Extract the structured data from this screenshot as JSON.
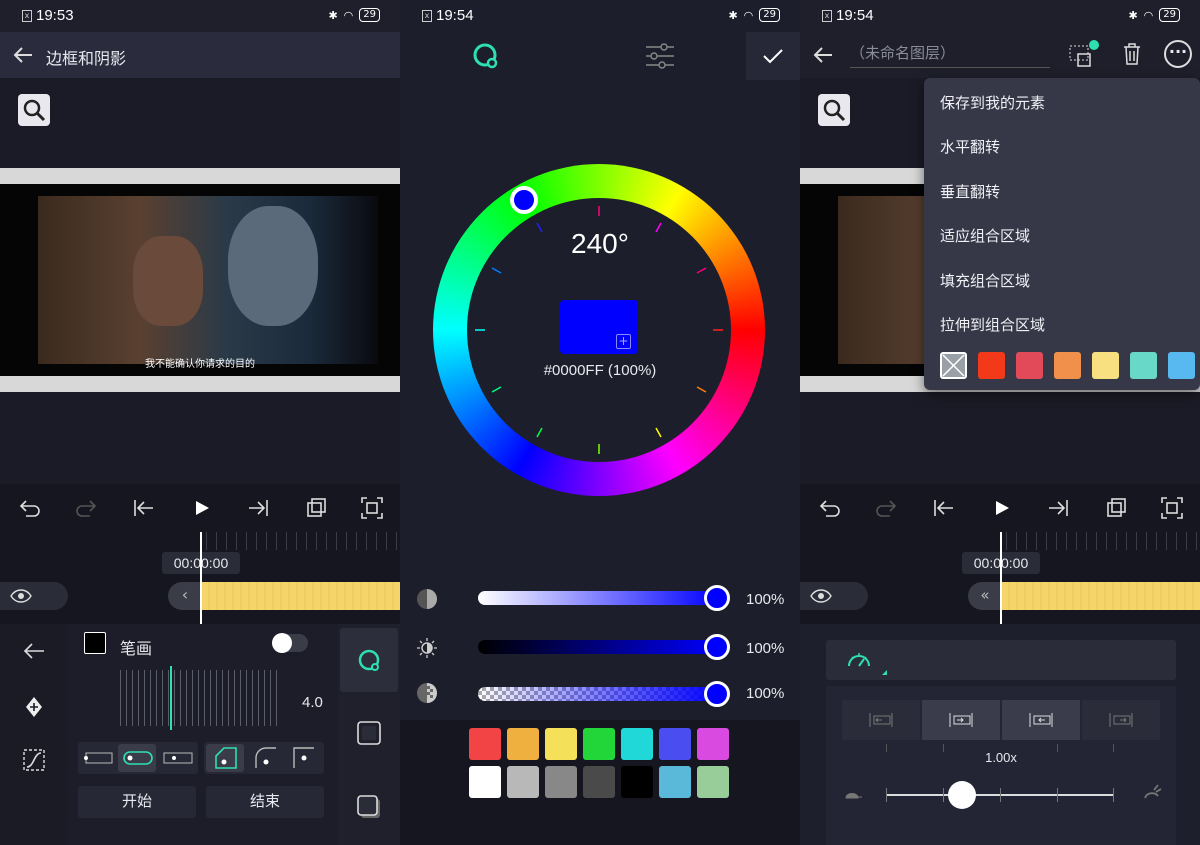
{
  "status": {
    "time_left": "19:53",
    "time_mid": "19:54",
    "time_right": "19:54",
    "battery": "29"
  },
  "left": {
    "header_title": "边框和阴影",
    "subtitle": "我不能确认你请求的目的",
    "timecode": "00:00:00",
    "stroke_label": "笔画",
    "stroke_value": "4.0",
    "start_label": "开始",
    "end_label": "结束"
  },
  "mid": {
    "hue": "240°",
    "hex": "#0000FF (100%)",
    "sliders": [
      {
        "name": "saturation",
        "value": "100%",
        "level": 1.0
      },
      {
        "name": "brightness",
        "value": "100%",
        "level": 1.0
      },
      {
        "name": "opacity",
        "value": "100%",
        "level": 1.0
      }
    ],
    "palette_row1": [
      "#f24444",
      "#f0b040",
      "#f5e05a",
      "#22d63a",
      "#20d8d8",
      "#4a4ef0",
      "#d84ae0"
    ],
    "palette_row2": [
      "#ffffff",
      "#b8b8b8",
      "#888888",
      "#4a4a4a",
      "#000000",
      "#5ab8d8",
      "#98cc98"
    ]
  },
  "right": {
    "layer_placeholder": "（未命名图层）",
    "menu": [
      "保存到我的元素",
      "水平翻转",
      "垂直翻转",
      "适应组合区域",
      "填充组合区域",
      "拉伸到组合区域"
    ],
    "menu_colors": [
      "none",
      "#f23a1a",
      "#e24a5a",
      "#f0904a",
      "#f8e080",
      "#68d8c8",
      "#58b8f0"
    ],
    "timecode": "00:00:00",
    "speed": "1.00x"
  },
  "colors": {
    "accent": "#2ee0b0",
    "selected": "#0000FF",
    "clip": "#f5d56a"
  }
}
